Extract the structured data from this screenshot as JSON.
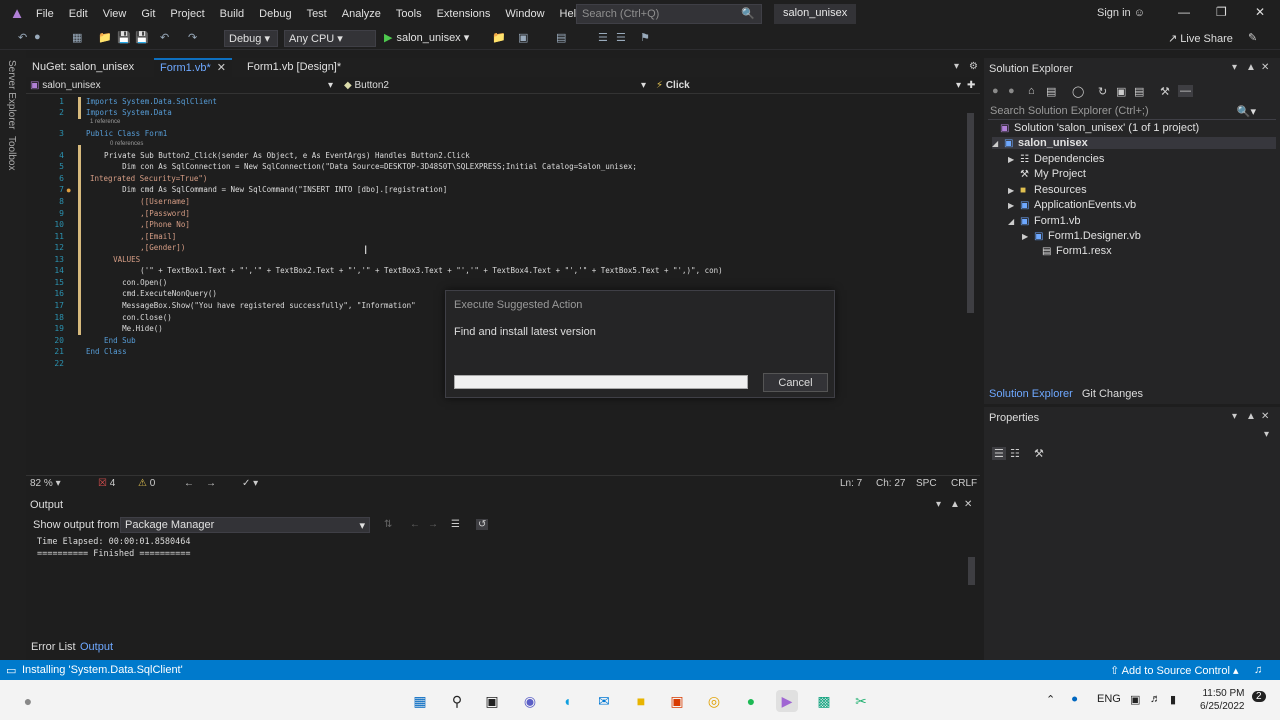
{
  "menubar": {
    "items": [
      "File",
      "Edit",
      "View",
      "Git",
      "Project",
      "Build",
      "Debug",
      "Test",
      "Analyze",
      "Tools",
      "Extensions",
      "Window",
      "Help"
    ],
    "search_placeholder": "Search (Ctrl+Q)",
    "solution_name": "salon_unisex",
    "sign_in": "Sign in"
  },
  "toolbar": {
    "config": "Debug",
    "platform": "Any CPU",
    "run_target": "salon_unisex",
    "live_share": "Live Share"
  },
  "sidestrip": {
    "server_explorer": "Server Explorer",
    "toolbox": "Toolbox"
  },
  "doc_tabs": [
    {
      "label": "NuGet: salon_unisex",
      "active": false
    },
    {
      "label": "Form1.vb*",
      "active": true
    },
    {
      "label": "Form1.vb [Design]*",
      "active": false
    }
  ],
  "navbar": {
    "project": "salon_unisex",
    "object": "Button2",
    "event": "Click"
  },
  "code": {
    "line_numbers": [
      "1",
      "2",
      "3",
      "4",
      "5",
      "6",
      "7",
      "8",
      "9",
      "10",
      "11",
      "12",
      "13",
      "14",
      "15",
      "16",
      "17",
      "18",
      "19",
      "20",
      "21",
      "22"
    ],
    "ref1": "1 reference",
    "ref2": "0 references",
    "l1": "Imports System.Data.SqlClient",
    "l2": "Imports System.Data",
    "l3": "Public Class Form1",
    "l4": "    Private Sub Button2_Click(sender As Object, e As EventArgs) Handles Button2.Click",
    "l5": "        Dim con As SqlConnection = New SqlConnection(\"Data Source=DESKTOP-3D48S0T\\SQLEXPRESS;Initial Catalog=Salon_unisex;",
    "l6": "Integrated Security=True\")",
    "l7": "        Dim cmd As SqlCommand = New SqlCommand(\"INSERT INTO [dbo].[registration]",
    "l8": "            ([Username]",
    "l9": "            ,[Password]",
    "l10": "            ,[Phone No]",
    "l11": "            ,[Email]",
    "l12": "            ,[Gender])",
    "l13": "      VALUES",
    "l14": "            ('\" + TextBox1.Text + \"','\" + TextBox2.Text + \"','\" + TextBox3.Text + \"','\" + TextBox4.Text + \"','\" + TextBox5.Text + \"',)\", con)",
    "l15": "        con.Open()",
    "l16": "        cmd.ExecuteNonQuery()",
    "l17": "        MessageBox.Show(\"You have registered successfully\", \"Information\"",
    "l18": "        con.Close()",
    "l19": "        Me.Hide()",
    "l20": "    End Sub",
    "l21": "End Class"
  },
  "editor_status": {
    "zoom": "82 %",
    "errors": "4",
    "warnings": "0",
    "line": "Ln: 7",
    "col": "Ch: 27",
    "spc": "SPC",
    "eol": "CRLF"
  },
  "output": {
    "title": "Output",
    "show_from_label": "Show output from:",
    "source": "Package Manager",
    "lines": [
      "Time Elapsed: 00:00:01.8580464",
      "========== Finished =========="
    ]
  },
  "bottom_tabs": {
    "error_list": "Error List",
    "output": "Output"
  },
  "solution_explorer": {
    "title": "Solution Explorer",
    "search_placeholder": "Search Solution Explorer (Ctrl+;)",
    "tree": {
      "solution": "Solution 'salon_unisex' (1 of 1 project)",
      "project": "salon_unisex",
      "dependencies": "Dependencies",
      "my_project": "My Project",
      "resources": "Resources",
      "app_events": "ApplicationEvents.vb",
      "form1": "Form1.vb",
      "form1_designer": "Form1.Designer.vb",
      "form1_resx": "Form1.resx"
    },
    "tab_solution": "Solution Explorer",
    "tab_git": "Git Changes"
  },
  "properties": {
    "title": "Properties"
  },
  "dialog": {
    "title": "Execute Suggested Action",
    "message": "Find and install latest version",
    "cancel": "Cancel",
    "progress": 0
  },
  "statusbar": {
    "message": "Installing 'System.Data.SqlClient'",
    "source_control": "Add to Source Control"
  },
  "taskbar": {
    "lang": "ENG",
    "time": "11:50 PM",
    "date": "6/25/2022",
    "notif": "2"
  },
  "colors": {
    "accent": "#007acc",
    "editor_bg": "#1e1e1e",
    "progress_fill": "#06b025"
  }
}
